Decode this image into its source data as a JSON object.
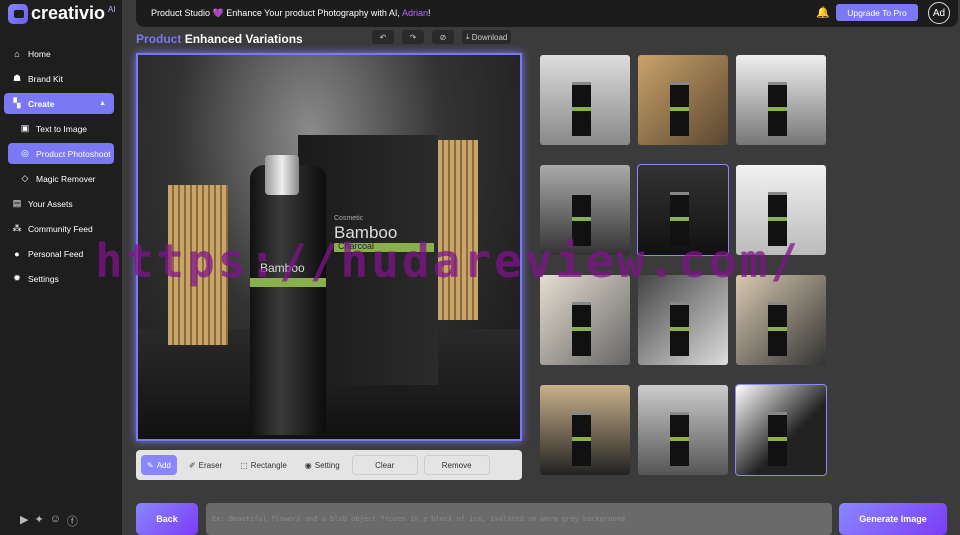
{
  "app": {
    "name": "creativio",
    "badge": "AI"
  },
  "sidebar": {
    "items": [
      {
        "label": "Home",
        "icon": "home-icon"
      },
      {
        "label": "Brand Kit",
        "icon": "brand-icon"
      },
      {
        "label": "Create",
        "icon": "grid-icon"
      },
      {
        "label": "Text to Image",
        "icon": "image-icon"
      },
      {
        "label": "Product Photoshoot",
        "icon": "camera-icon"
      },
      {
        "label": "Magic Remover",
        "icon": "eraser-icon"
      },
      {
        "label": "Your Assets",
        "icon": "assets-icon"
      },
      {
        "label": "Community Feed",
        "icon": "community-icon"
      },
      {
        "label": "Personal Feed",
        "icon": "user-icon"
      },
      {
        "label": "Settings",
        "icon": "gear-icon"
      }
    ]
  },
  "topbar": {
    "welcome": "Product Studio",
    "emoji": "💜",
    "tagline": "Enhance Your product Photography with AI,",
    "user": "Adrian",
    "exclaim": "!",
    "upgrade": "Upgrade To Pro",
    "avatar": "Ad"
  },
  "editor": {
    "title_highlight": "Product",
    "title_rest": "Enhanced Variations",
    "download": "Download",
    "product_label": "Bamboo",
    "product_sub": "Charcoal",
    "box_brand": "Cosmetic"
  },
  "toolbar": {
    "add": "Add",
    "eraser": "Eraser",
    "rectangle": "Rectangle",
    "setting": "Setting",
    "clear": "Clear",
    "remove": "Remove"
  },
  "thumbnails": {
    "count": 12,
    "selected": [
      4,
      11
    ]
  },
  "bottom": {
    "back": "Back",
    "placeholder": "Ex: Beautiful flowers and a blob object frozen in a block of ice, isolated on warm grey background",
    "generate": "Generate Image"
  },
  "watermark": "https://hudareview.com/",
  "colors": {
    "accent": "#7b78f5",
    "name": "#b06cff"
  }
}
